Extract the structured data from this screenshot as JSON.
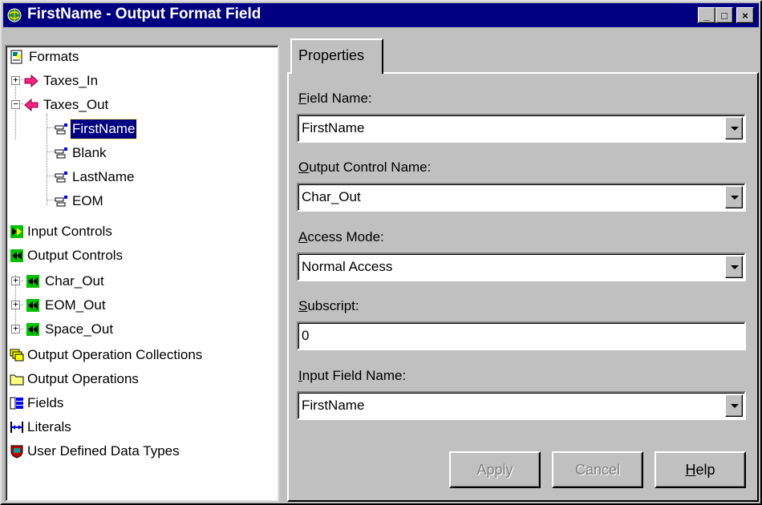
{
  "window": {
    "title": "FirstName - Output Format Field",
    "controls": {
      "minimize": "_",
      "maximize": "□",
      "close": "×"
    }
  },
  "tree": {
    "items": [
      {
        "label": "Formats",
        "icon": "formats-icon"
      },
      {
        "label": "Taxes_In",
        "icon": "input-arrow-icon"
      },
      {
        "label": "Taxes_Out",
        "icon": "output-arrow-icon"
      },
      {
        "label": "FirstName",
        "icon": "field-icon",
        "selected": true
      },
      {
        "label": "Blank",
        "icon": "field-icon"
      },
      {
        "label": "LastName",
        "icon": "field-icon"
      },
      {
        "label": "EOM",
        "icon": "field-icon"
      },
      {
        "label": "Input Controls",
        "icon": "input-controls-icon"
      },
      {
        "label": "Output Controls",
        "icon": "output-controls-icon"
      },
      {
        "label": "Char_Out",
        "icon": "output-control-icon"
      },
      {
        "label": "EOM_Out",
        "icon": "output-control-icon"
      },
      {
        "label": "Space_Out",
        "icon": "output-control-icon"
      },
      {
        "label": "Output Operation Collections",
        "icon": "collections-icon"
      },
      {
        "label": "Output Operations",
        "icon": "folder-icon"
      },
      {
        "label": "Fields",
        "icon": "fields-icon"
      },
      {
        "label": "Literals",
        "icon": "literals-icon"
      },
      {
        "label": "User Defined Data Types",
        "icon": "udt-icon"
      }
    ]
  },
  "tabs": [
    {
      "label": "Properties",
      "active": true
    }
  ],
  "form": {
    "field_name": {
      "label_key": "F",
      "label_rest": "ield Name:",
      "value": "FirstName"
    },
    "output_control_name": {
      "label_key": "O",
      "label_rest": "utput Control Name:",
      "value": "Char_Out"
    },
    "access_mode": {
      "label_key": "A",
      "label_rest": "ccess Mode:",
      "value": "Normal Access"
    },
    "subscript": {
      "label_key": "S",
      "label_rest": "ubscript:",
      "value": "0"
    },
    "input_field_name": {
      "label_key": "I",
      "label_rest": "nput Field Name:",
      "value": "FirstName"
    }
  },
  "buttons": {
    "apply": "Apply",
    "cancel": "Cancel",
    "help_key": "H",
    "help_rest": "elp"
  },
  "colors": {
    "titlebar": "#000080",
    "face": "#c0c0c0",
    "selection": "#000080"
  }
}
